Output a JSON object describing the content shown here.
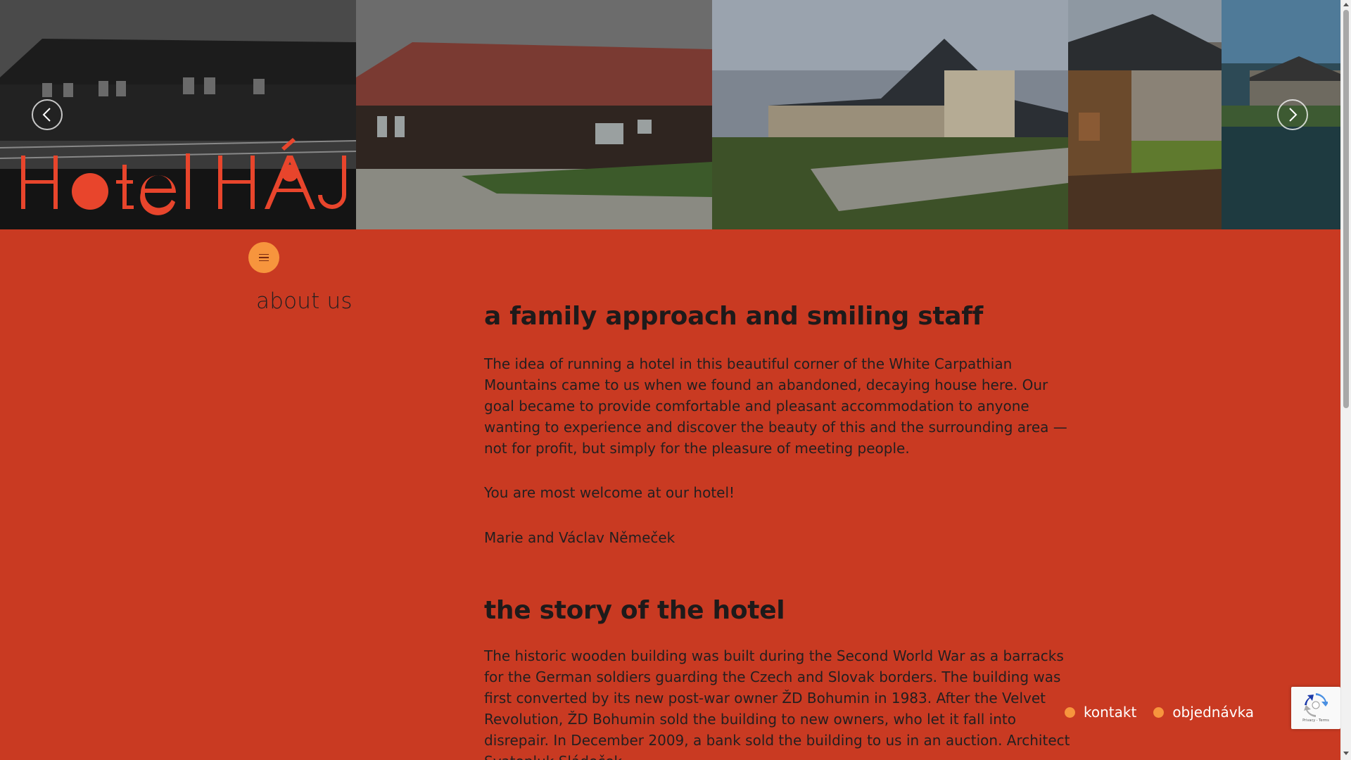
{
  "hero": {
    "logo_text": "Hotel HÁJ",
    "prev_label": "previous",
    "next_label": "next"
  },
  "nav": {
    "section_label": "about us"
  },
  "sections": [
    {
      "heading": "a family approach and smiling staff",
      "paragraphs": [
        "The idea of running a hotel in this beautiful corner of the White Carpathian Mountains came to us when we found an abandoned, decaying house here. Our goal became to provide comfortable and pleasant accommodation to anyone wanting to experience and discover the beauty of this and the surrounding area —not for profit, but simply for the pleasure of meeting people.",
        "You are most welcome at our hotel!",
        "Marie and Václav Němeček"
      ]
    },
    {
      "heading": "the story of the hotel",
      "paragraphs": [
        "The historic wooden building was built during the Second World War as a barracks for the German soldiers guarding the Czech and Slovak borders. The building was first converted by its new post-war owner ŽD Bohumin in 1983. After the Velvet Revolution, ŽD Bohumin sold the building to new owners, who let it fall into disrepair. In December 2009, a bank sold the building to us in an auction. Architect Svatopluk Sládeček"
      ]
    }
  ],
  "float_links": [
    {
      "label": "kontakt"
    },
    {
      "label": "objednávka"
    }
  ],
  "recaptcha": {
    "text": "Privacy - Terms"
  },
  "colors": {
    "background": "#c93a22",
    "accent": "#f7953d",
    "text": "#231f20"
  }
}
